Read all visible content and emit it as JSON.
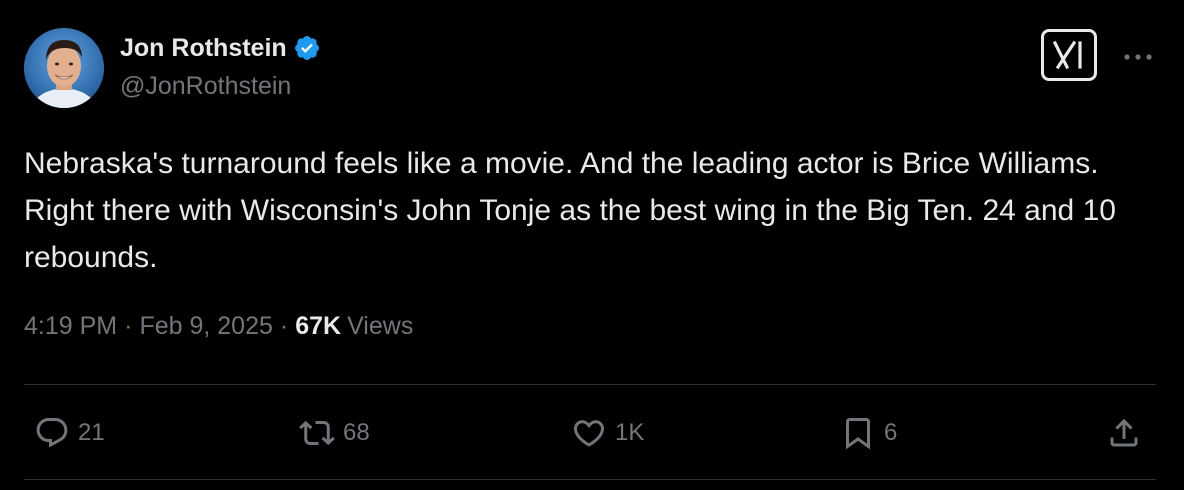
{
  "author": {
    "display_name": "Jon Rothstein",
    "handle": "@JonRothstein",
    "verified": true,
    "avatar_icon": "profile-photo"
  },
  "header_actions": {
    "grok_icon": "grok-icon",
    "more_icon": "more-dots-icon"
  },
  "tweet": {
    "text": "Nebraska's turnaround feels like a movie. And the leading actor is Brice Williams. Right there with Wisconsin's John Tonje as the best wing in the Big Ten. 24 and 10 rebounds."
  },
  "meta": {
    "time": "4:19 PM",
    "separator": "·",
    "date": "Feb 9, 2025",
    "views_count": "67K",
    "views_label": "Views"
  },
  "actions": {
    "reply": {
      "icon": "reply-icon",
      "count": "21"
    },
    "repost": {
      "icon": "repost-icon",
      "count": "68"
    },
    "like": {
      "icon": "heart-icon",
      "count": "1K"
    },
    "bookmark": {
      "icon": "bookmark-icon",
      "count": "6"
    },
    "share": {
      "icon": "share-icon"
    }
  },
  "colors": {
    "background": "#000000",
    "primary_text": "#e7e9ea",
    "secondary_text": "#71767b",
    "divider": "#2f3336",
    "verified_badge": "#1d9bf0"
  }
}
